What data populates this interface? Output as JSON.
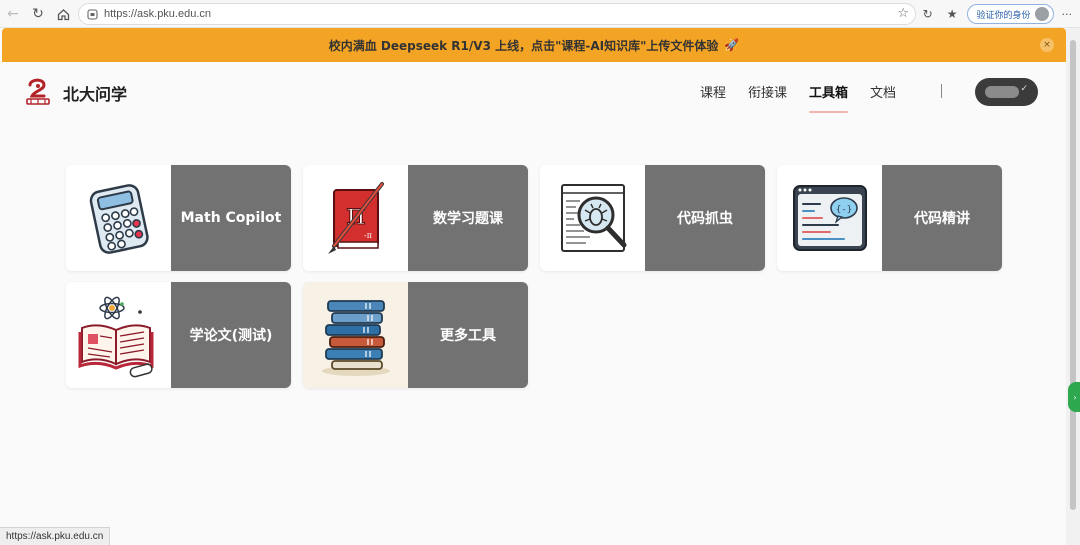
{
  "browser": {
    "url": "https://ask.pku.edu.cn",
    "verify_label": "验证你的身份",
    "menu_label": "···"
  },
  "banner": {
    "text": "校内满血 Deepseek R1/V3 上线，点击\"课程-AI知识库\"上传文件体验",
    "close": "×"
  },
  "header": {
    "site_title": "北大问学",
    "nav": [
      {
        "label": "课程",
        "active": false
      },
      {
        "label": "衔接课",
        "active": false
      },
      {
        "label": "工具箱",
        "active": true
      },
      {
        "label": "文档",
        "active": false
      }
    ]
  },
  "tools": [
    {
      "label": "Math Copilot",
      "icon": "calculator-icon"
    },
    {
      "label": "数学习题课",
      "icon": "pi-book-icon"
    },
    {
      "label": "代码抓虫",
      "icon": "bug-magnifier-icon"
    },
    {
      "label": "代码精讲",
      "icon": "code-chat-icon"
    },
    {
      "label": "学论文(测试)",
      "icon": "open-book-atom-icon"
    },
    {
      "label": "更多工具",
      "icon": "book-stack-icon"
    }
  ],
  "status_bar": {
    "url": "https://ask.pku.edu.cn"
  },
  "colors": {
    "banner": "#f4a424",
    "card_label_bg": "#727272",
    "active_underline": "#f2b4ae"
  }
}
